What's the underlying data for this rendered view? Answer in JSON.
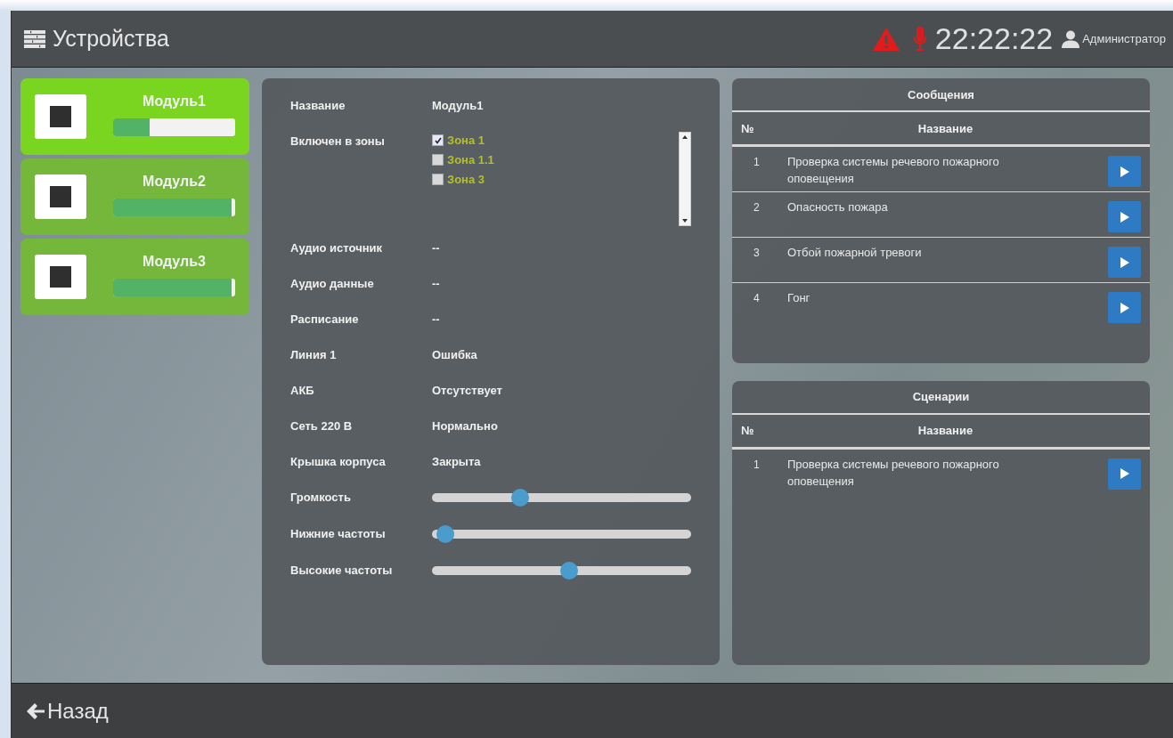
{
  "header": {
    "title": "Устройства",
    "clock": "22:22:22",
    "user": "Администратор"
  },
  "modules": [
    {
      "name": "Модуль1",
      "selected": true,
      "level": 0.3
    },
    {
      "name": "Модуль2",
      "selected": false,
      "level": 0.97
    },
    {
      "name": "Модуль3",
      "selected": false,
      "level": 0.97
    }
  ],
  "details": {
    "rows": [
      {
        "kind": "text",
        "label": "Название",
        "value": "Модуль1"
      },
      {
        "kind": "zones",
        "label": "Включен в зоны",
        "zones": [
          {
            "name": "Зона 1",
            "checked": true
          },
          {
            "name": "Зона 1.1",
            "checked": false
          },
          {
            "name": "Зона 3",
            "checked": false
          }
        ]
      },
      {
        "kind": "text",
        "label": "Аудио источник",
        "value": "--"
      },
      {
        "kind": "text",
        "label": "Аудио данные",
        "value": "--"
      },
      {
        "kind": "text",
        "label": "Расписание",
        "value": "--"
      },
      {
        "kind": "text",
        "label": "Линия 1",
        "value": "Ошибка"
      },
      {
        "kind": "text",
        "label": "АКБ",
        "value": "Отсутствует"
      },
      {
        "kind": "text",
        "label": "Сеть 220 В",
        "value": "Нормально"
      },
      {
        "kind": "text",
        "label": "Крышка корпуса",
        "value": "Закрыта"
      },
      {
        "kind": "slider",
        "label": "Громкость",
        "level": 0.33
      },
      {
        "kind": "slider",
        "label": "Нижние частоты",
        "level": 0.02
      },
      {
        "kind": "slider",
        "label": "Высокие частоты",
        "level": 0.53
      }
    ]
  },
  "messages": {
    "title": "Сообщения",
    "columns": [
      "№",
      "Название"
    ],
    "rows": [
      {
        "number": "1",
        "name": "Проверка системы речевого пожарного оповещения"
      },
      {
        "number": "2",
        "name": "Опасность пожара"
      },
      {
        "number": "3",
        "name": "Отбой пожарной тревоги"
      },
      {
        "number": "4",
        "name": "Гонг"
      }
    ]
  },
  "scenarios": {
    "title": "Сценарии",
    "columns": [
      "№",
      "Название"
    ],
    "rows": [
      {
        "number": "1",
        "name": "Проверка системы речевого пожарного оповещения"
      }
    ]
  },
  "footer": {
    "back": "Назад"
  }
}
